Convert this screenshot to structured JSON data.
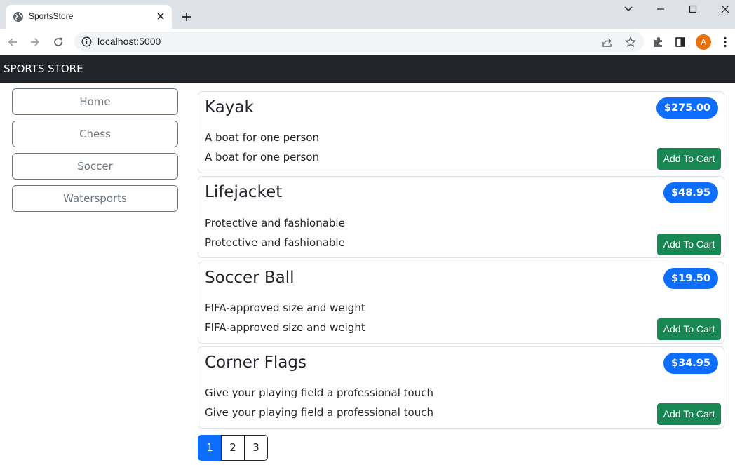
{
  "browser": {
    "tab_title": "SportsStore",
    "url": "localhost:5000",
    "avatar_letter": "A"
  },
  "store": {
    "brand": "SPORTS STORE",
    "categories": [
      "Home",
      "Chess",
      "Soccer",
      "Watersports"
    ],
    "add_label": "Add To Cart",
    "products": [
      {
        "name": "Kayak",
        "price": "$275.00",
        "description": "A boat for one person"
      },
      {
        "name": "Lifejacket",
        "price": "$48.95",
        "description": "Protective and fashionable"
      },
      {
        "name": "Soccer Ball",
        "price": "$19.50",
        "description": "FIFA-approved size and weight"
      },
      {
        "name": "Corner Flags",
        "price": "$34.95",
        "description": "Give your playing field a professional touch"
      }
    ],
    "pages": [
      "1",
      "2",
      "3"
    ],
    "current_page": "1"
  },
  "colors": {
    "navbar": "#212529",
    "primary": "#0d6efd",
    "success": "#198754",
    "outline": "#6c757d"
  }
}
